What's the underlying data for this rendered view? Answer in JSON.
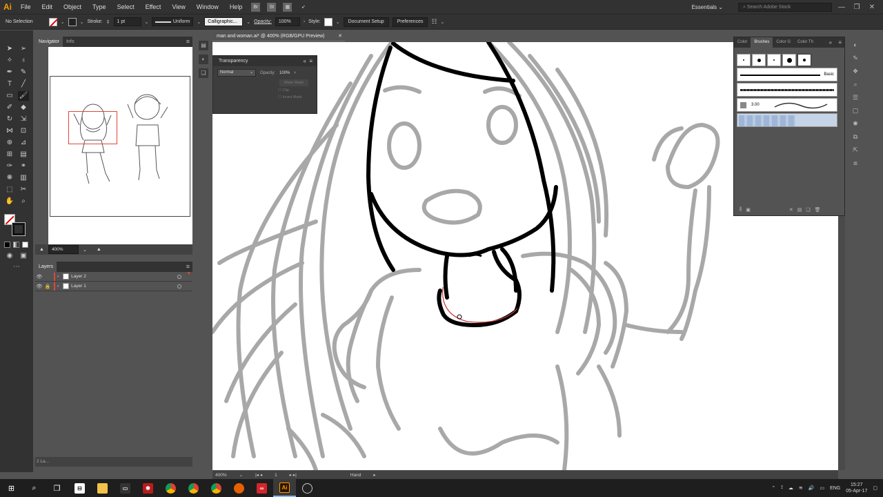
{
  "app": {
    "logo": "Ai",
    "menu": [
      "File",
      "Edit",
      "Object",
      "Type",
      "Select",
      "Effect",
      "View",
      "Window",
      "Help"
    ],
    "menu_buttons": [
      "Br",
      "St"
    ],
    "workspace": "Essentials",
    "search_placeholder": "Search Adobe Stock"
  },
  "control_bar": {
    "selection": "No Selection",
    "stroke_label": "Stroke:",
    "stroke_weight": "1 pt",
    "profile": "Uniform",
    "brush": "Calligraphic...",
    "opacity_label": "Opacity:",
    "opacity": "100%",
    "style_label": "Style:",
    "document_setup": "Document Setup",
    "preferences": "Preferences"
  },
  "navigator": {
    "tabs": [
      "Navigator",
      "Info"
    ],
    "zoom": "400%"
  },
  "layers": {
    "title": "Layers",
    "rows": [
      {
        "name": "Layer 2",
        "color": "#e0473a",
        "locked": false
      },
      {
        "name": "Layer 1",
        "color": "#e0473a",
        "locked": true
      }
    ],
    "footer": "2 La..."
  },
  "document": {
    "tab_title": "man and woman.ai* @ 400% (RGB/GPU Preview)",
    "status_zoom": "400%",
    "status_page": "1",
    "status_tool": "Hand"
  },
  "transparency": {
    "title": "Transparency",
    "blend_mode": "Normal",
    "opacity_label": "Opacity:",
    "opacity": "100%",
    "make_mask": "Make Mask",
    "clip": "Clip",
    "invert_mask": "Invert Mask"
  },
  "brushes_panel": {
    "tabs": [
      "Color",
      "Brushes",
      "Color G",
      "Color Th"
    ],
    "basic_label": "Basic",
    "size_label": "3.00"
  },
  "taskbar": {
    "language": "ENG",
    "time": "15:27",
    "date": "05-Apr-17"
  },
  "colors": {
    "accent_orange": "#ff9a00",
    "layer_red": "#e0473a",
    "panel_dark": "#323232",
    "panel_mid": "#535353"
  }
}
